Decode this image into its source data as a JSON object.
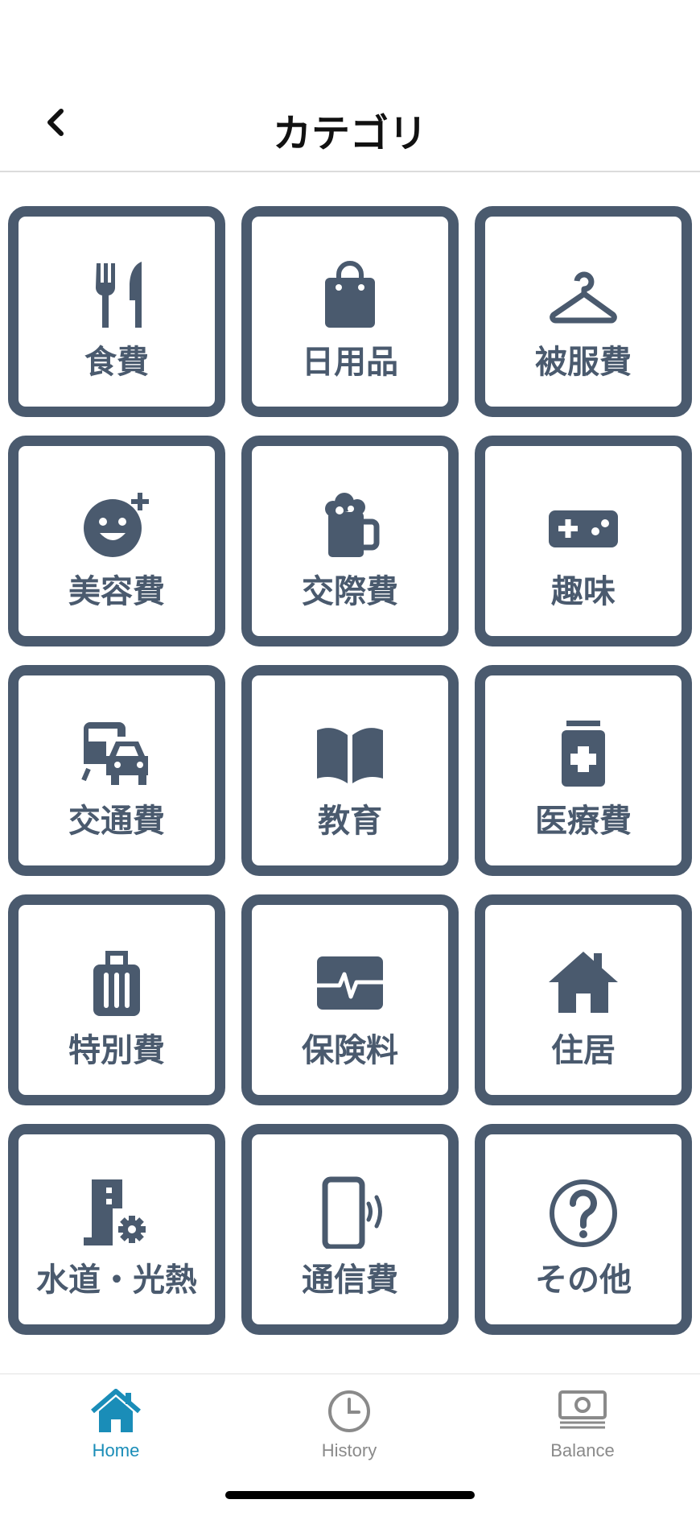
{
  "header": {
    "title": "カテゴリ",
    "back_icon": "chevron-left-icon"
  },
  "categories": [
    {
      "label": "食費",
      "icon": "fork-knife-icon"
    },
    {
      "label": "日用品",
      "icon": "shopping-bag-icon"
    },
    {
      "label": "被服費",
      "icon": "hanger-icon"
    },
    {
      "label": "美容費",
      "icon": "face-sparkle-icon"
    },
    {
      "label": "交際費",
      "icon": "beer-mug-icon"
    },
    {
      "label": "趣味",
      "icon": "gamepad-icon"
    },
    {
      "label": "交通費",
      "icon": "bus-car-icon"
    },
    {
      "label": "教育",
      "icon": "open-book-icon"
    },
    {
      "label": "医療費",
      "icon": "medicine-bottle-icon"
    },
    {
      "label": "特別費",
      "icon": "suitcase-icon"
    },
    {
      "label": "保険料",
      "icon": "heartbeat-icon"
    },
    {
      "label": "住居",
      "icon": "house-icon"
    },
    {
      "label": "水道・光熱",
      "icon": "building-gear-icon"
    },
    {
      "label": "通信費",
      "icon": "phone-vibrate-icon"
    },
    {
      "label": "その他",
      "icon": "question-circle-icon"
    }
  ],
  "tabbar": {
    "tabs": [
      {
        "label": "Home",
        "icon": "home-icon",
        "active": true
      },
      {
        "label": "History",
        "icon": "clock-icon",
        "active": false
      },
      {
        "label": "Balance",
        "icon": "money-icon",
        "active": false
      }
    ],
    "active_color": "#1a8db8",
    "inactive_color": "#8a8a8a"
  },
  "colors": {
    "tile": "#4a5a6e"
  }
}
